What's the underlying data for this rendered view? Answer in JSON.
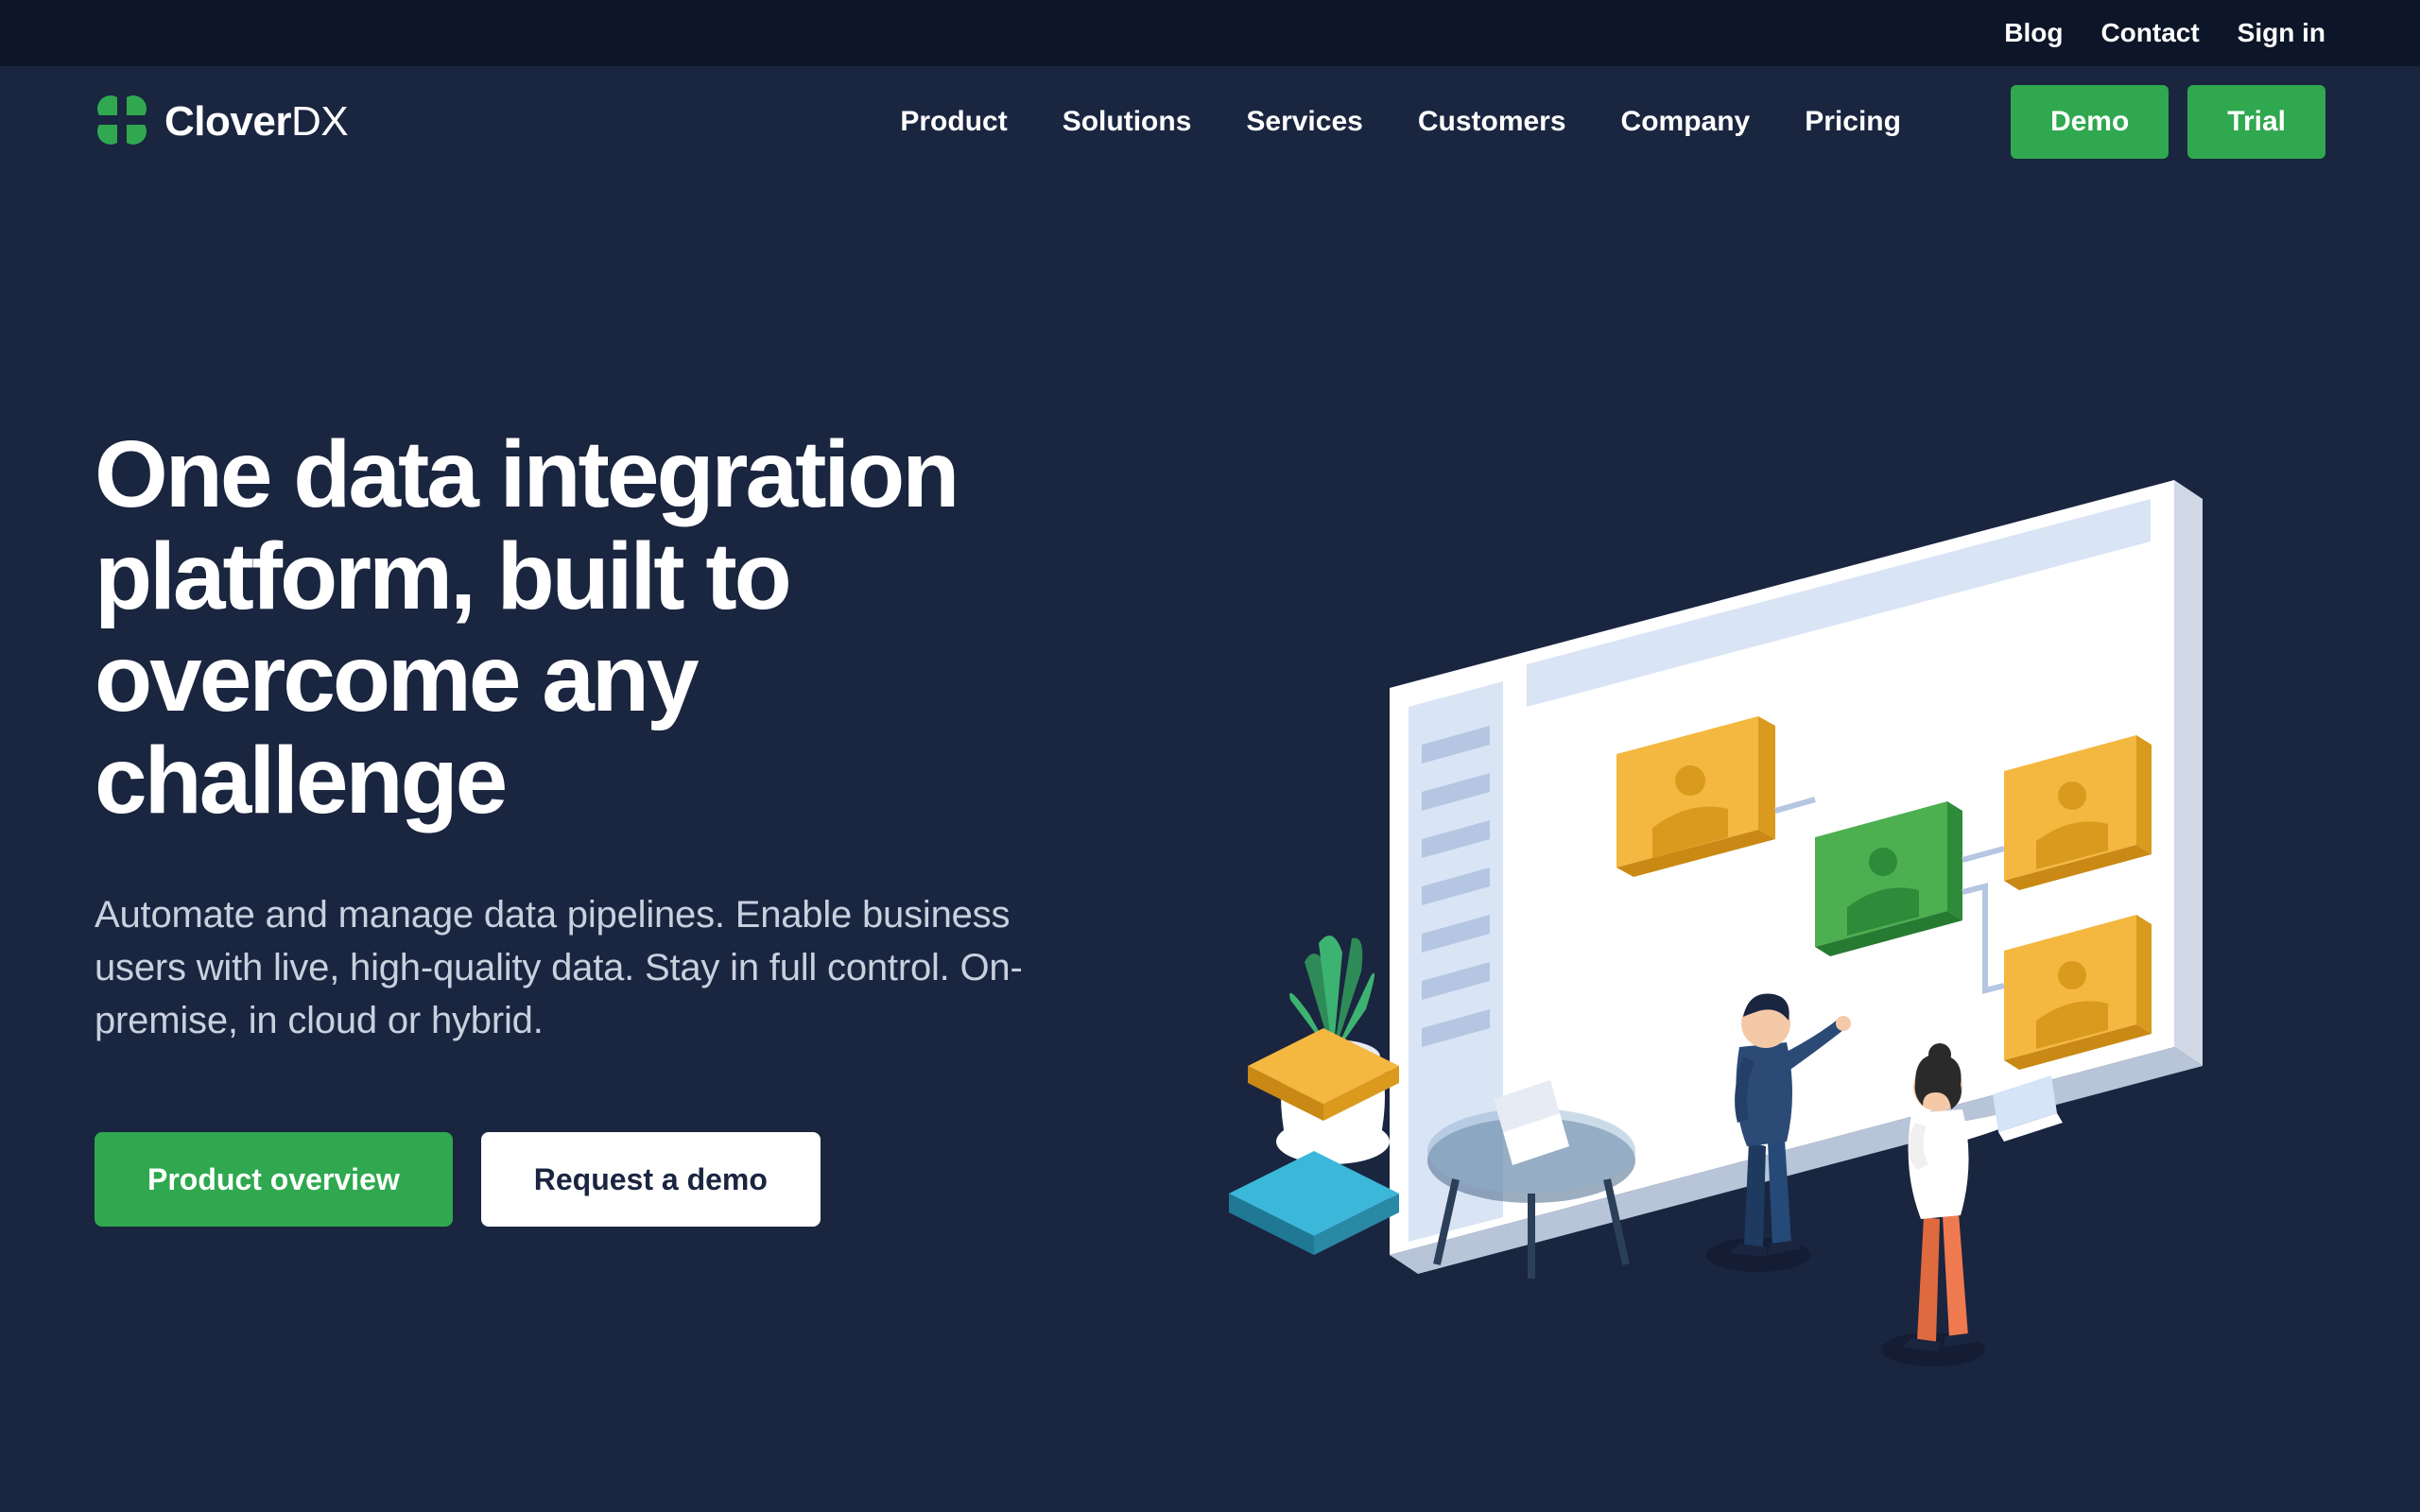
{
  "topbar": {
    "blog": "Blog",
    "contact": "Contact",
    "signin": "Sign in"
  },
  "brand": {
    "name_bold": "Clover",
    "name_light": "DX"
  },
  "nav": {
    "product": "Product",
    "solutions": "Solutions",
    "services": "Services",
    "customers": "Customers",
    "company": "Company",
    "pricing": "Pricing",
    "demo": "Demo",
    "trial": "Trial"
  },
  "hero": {
    "title": "One data integration platform, built to overcome any challenge",
    "subtitle": "Automate and manage data pipelines. Enable business users with live, high-quality data. Stay in full control. On-premise, in cloud or hybrid.",
    "cta_primary": "Product overview",
    "cta_secondary": "Request a demo"
  },
  "colors": {
    "green": "#2fa84f",
    "bg": "#1a2540",
    "topbar": "#0d1628",
    "yellow": "#f4b740",
    "yellow_dark": "#d99a1e",
    "green_node": "#4caf50",
    "green_node_dark": "#2e8b3a",
    "panel": "#ffffff",
    "panel_blue": "#d9e4f5",
    "cyan": "#3bb7d9",
    "cyan_dark": "#2a8aa5"
  }
}
